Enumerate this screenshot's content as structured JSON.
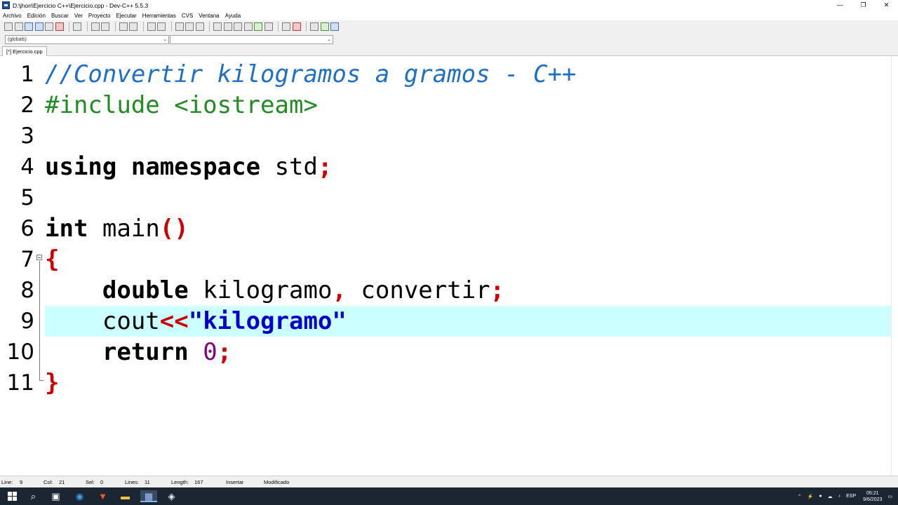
{
  "window": {
    "title": "D:\\jhon\\Ejercicio C++\\Ejercicio.cpp - Dev-C++ 5.5.3",
    "minimize": "—",
    "maximize": "❐",
    "close": "✕"
  },
  "menu": [
    "Archivo",
    "Edición",
    "Buscar",
    "Ver",
    "Proyecto",
    "Ejecutar",
    "Herramientas",
    "CVS",
    "Ventana",
    "Ayuda"
  ],
  "scope_combo": {
    "value": "(globals)"
  },
  "function_combo": {
    "value": ""
  },
  "tab": {
    "label": "[*] Ejercicio.cpp"
  },
  "editor": {
    "current_line": 9,
    "lines": [
      {
        "n": "1"
      },
      {
        "n": "2"
      },
      {
        "n": "3"
      },
      {
        "n": "4"
      },
      {
        "n": "5"
      },
      {
        "n": "6"
      },
      {
        "n": "7"
      },
      {
        "n": "8"
      },
      {
        "n": "9"
      },
      {
        "n": "10"
      },
      {
        "n": "11"
      }
    ],
    "code": {
      "l1_comment": "//Convertir kilogramos a gramos - C++",
      "l2_pre": "#include <iostream>",
      "l4_kw1": "using",
      "l4_kw2": "namespace",
      "l4_id": "std",
      "l4_semi": ";",
      "l6_kw": "int",
      "l6_id": "main",
      "l6_parens": "()",
      "l7_brace": "{",
      "l8_kw": "double",
      "l8_id1": "kilogramo",
      "l8_comma": ",",
      "l8_id2": "convertir",
      "l8_semi": ";",
      "l9_id": "cout",
      "l9_op": "<<",
      "l9_str": "\"kilogramo\"",
      "l10_kw": "return",
      "l10_num": "0",
      "l10_semi": ";",
      "l11_brace": "}"
    }
  },
  "status": {
    "line_label": "Line:",
    "line_val": "9",
    "col_label": "Col:",
    "col_val": "21",
    "sel_label": "Sel:",
    "sel_val": "0",
    "lines_label": "Lines:",
    "lines_val": "11",
    "length_label": "Length:",
    "length_val": "167",
    "mode": "Insertar",
    "state": "Modificado"
  },
  "taskbar": {
    "lang": "ESP",
    "time": "05:21",
    "date": "9/6/2023"
  }
}
